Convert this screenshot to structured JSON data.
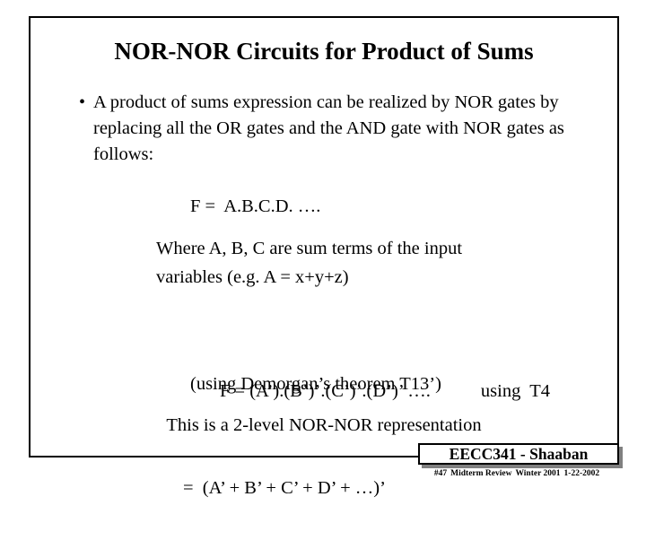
{
  "slide": {
    "title": "NOR-NOR Circuits for Product of Sums",
    "bullet": {
      "marker": "•",
      "text": "A product of sums expression can be realized by NOR gates by replacing all the OR gates and the AND gate with NOR gates as follows:"
    },
    "equation_main": "F =  A.B.C.D. ….",
    "where_line1": "Where A,  B, C are sum terms of the input",
    "where_line2": "variables  (e.g.  A = x+y+z)",
    "equation_expanded_line1": "F = (A’).(B’)’.(C’)’.(D’)’ ….",
    "equation_expanded_note": "using  T4",
    "equation_expanded_line2": "=  (A’ + B’ + C’ + D’ + …)’",
    "demorgan_note": "(using Demorgan’s theorem T13’)",
    "final_line": "This is a 2-level NOR-NOR representation",
    "footer": {
      "course": "EECC341 - Shaaban",
      "slide_number": "#47",
      "exam": "Midterm Review",
      "term": "Winter 2001",
      "date": "1-22-2002"
    }
  }
}
